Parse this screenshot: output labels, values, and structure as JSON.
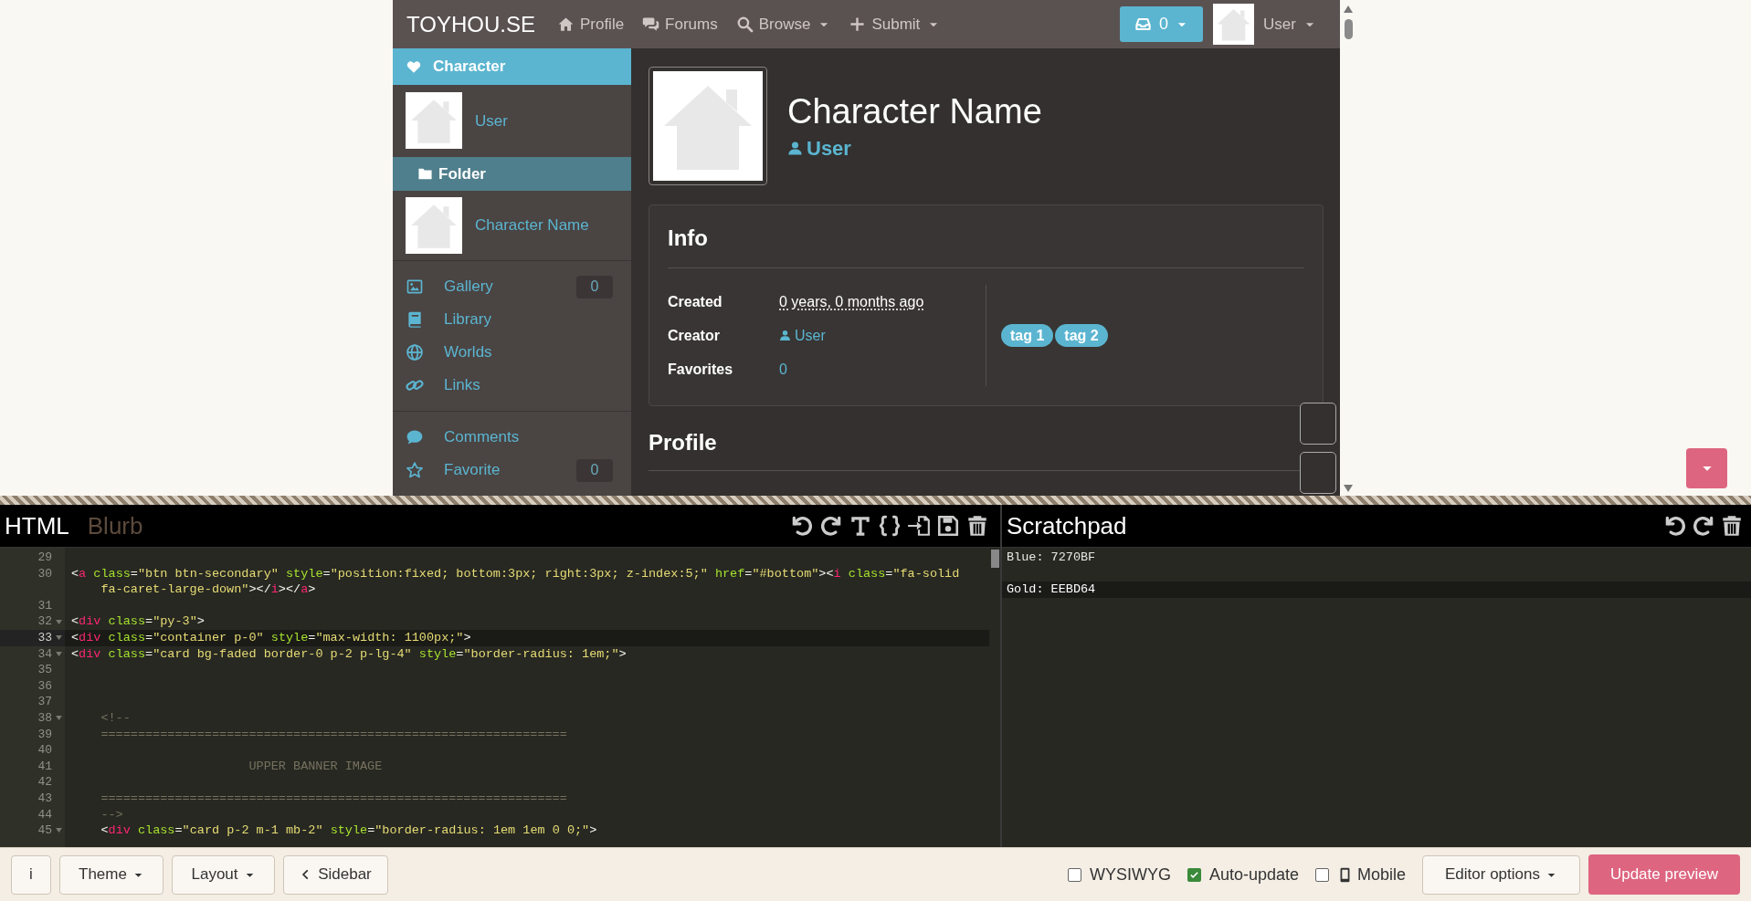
{
  "preview": {
    "navbar": {
      "brand": "TOYHOU.SE",
      "links": [
        {
          "label": "Profile",
          "dropdown": false
        },
        {
          "label": "Forums",
          "dropdown": false
        },
        {
          "label": "Browse",
          "dropdown": true
        },
        {
          "label": "Submit",
          "dropdown": true
        }
      ],
      "inbox_count": "0",
      "user": "User"
    },
    "sidebar": {
      "header": "Character",
      "owner": "User",
      "folder": "Folder",
      "character": "Character Name",
      "menu_groups": [
        [
          {
            "label": "Gallery",
            "count": "0"
          },
          {
            "label": "Library"
          },
          {
            "label": "Worlds"
          },
          {
            "label": "Links"
          }
        ],
        [
          {
            "label": "Comments"
          },
          {
            "label": "Favorite",
            "count": "0"
          }
        ]
      ]
    },
    "character": {
      "name": "Character Name",
      "owner": "User"
    },
    "info": {
      "title": "Info",
      "rows": [
        {
          "label": "Created",
          "value": "0 years, 0 months ago",
          "kind": "date"
        },
        {
          "label": "Creator",
          "value": "User",
          "kind": "user"
        },
        {
          "label": "Favorites",
          "value": "0",
          "kind": "link"
        }
      ],
      "tags": [
        "tag 1",
        "tag 2"
      ]
    },
    "profile": {
      "title": "Profile"
    }
  },
  "editor": {
    "tabs": [
      {
        "label": "HTML",
        "selected": true
      },
      {
        "label": "Blurb",
        "selected": false
      }
    ],
    "lines": [
      {
        "number": "29",
        "fold": false,
        "active": false
      },
      {
        "number": "30",
        "fold": false,
        "active": false,
        "kind": "markup",
        "text": "<a class=\"btn btn-secondary\" style=\"position:fixed; bottom:3px; right:3px; z-index:5;\" href=\"#bottom\"><i class=\"fa-solid fa-caret-large-down\"></i></a>"
      },
      {
        "number": "31",
        "fold": false,
        "active": false
      },
      {
        "number": "32",
        "fold": true,
        "active": false,
        "kind": "markup",
        "text": "<div class=\"py-3\">"
      },
      {
        "number": "33",
        "fold": true,
        "active": true,
        "kind": "markup",
        "text": "<div class=\"container p-0\" style=\"max-width: 1100px;\">"
      },
      {
        "number": "34",
        "fold": true,
        "active": false,
        "kind": "markup",
        "text": "<div class=\"card bg-faded border-0 p-2 p-lg-4\" style=\"border-radius: 1em;\">"
      },
      {
        "number": "35",
        "fold": false,
        "active": false
      },
      {
        "number": "36",
        "fold": false,
        "active": false
      },
      {
        "number": "37",
        "fold": false,
        "active": false
      },
      {
        "number": "38",
        "fold": true,
        "active": false,
        "kind": "comment",
        "text": "    <!--"
      },
      {
        "number": "39",
        "fold": false,
        "active": false,
        "kind": "comment",
        "text": "    ==============================================================="
      },
      {
        "number": "40",
        "fold": false,
        "active": false
      },
      {
        "number": "41",
        "fold": false,
        "active": false,
        "kind": "comment",
        "text": "                        UPPER BANNER IMAGE"
      },
      {
        "number": "42",
        "fold": false,
        "active": false
      },
      {
        "number": "43",
        "fold": false,
        "active": false,
        "kind": "comment",
        "text": "    ==============================================================="
      },
      {
        "number": "44",
        "fold": false,
        "active": false,
        "kind": "comment",
        "text": "    -->"
      },
      {
        "number": "45",
        "fold": true,
        "active": false,
        "kind": "markup",
        "text": "    <div class=\"card p-2 m-1 mb-2\" style=\"border-radius: 1em 1em 0 0;\">"
      }
    ]
  },
  "scratchpad": {
    "title": "Scratchpad",
    "lines": [
      {
        "text": "Blue: 7270BF",
        "active": false
      },
      {
        "text": "Gold: EEBD64",
        "active": true
      }
    ]
  },
  "bottom_bar": {
    "buttons": [
      {
        "label": "i",
        "dropdown": false
      },
      {
        "label": "Theme",
        "dropdown": true
      },
      {
        "label": "Layout",
        "dropdown": true
      },
      {
        "label": "Sidebar",
        "dropdown": false
      }
    ],
    "options": [
      {
        "label": "WYSIWYG",
        "checked": false
      },
      {
        "label": "Auto-update",
        "checked": true
      },
      {
        "label": "Mobile",
        "checked": false
      }
    ],
    "editor_options": {
      "label": "Editor options",
      "dropdown": true
    },
    "update": "Update preview"
  }
}
